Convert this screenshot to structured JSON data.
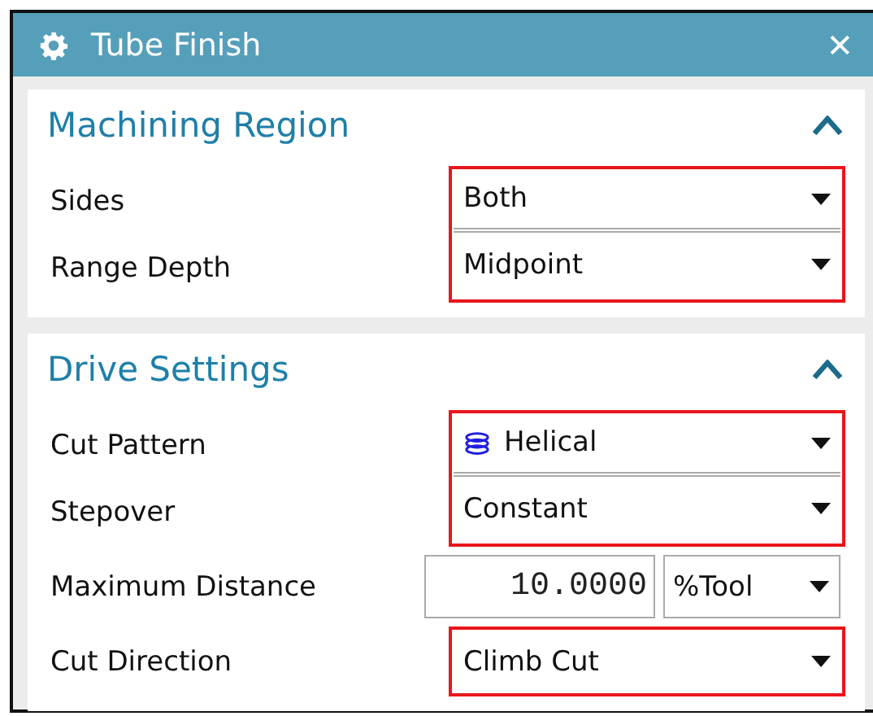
{
  "window": {
    "title": "Tube Finish",
    "close": "✕"
  },
  "sections": [
    {
      "title": "Machining Region",
      "expanded": true,
      "blocks": [
        {
          "highlighted": true,
          "rows": [
            {
              "label": "Sides",
              "kind": "dropdown",
              "value": "Both"
            },
            {
              "label": "Range Depth",
              "kind": "dropdown",
              "value": "Midpoint"
            }
          ]
        }
      ]
    },
    {
      "title": "Drive Settings",
      "expanded": true,
      "blocks": [
        {
          "highlighted": true,
          "rows": [
            {
              "label": "Cut Pattern",
              "kind": "icon_dropdown",
              "value": "Helical"
            },
            {
              "label": "Stepover",
              "kind": "dropdown",
              "value": "Constant"
            }
          ]
        },
        {
          "highlighted": false,
          "rows": [
            {
              "label": "Maximum Distance",
              "kind": "number",
              "value": "10.0000",
              "unit": "%Tool"
            }
          ]
        },
        {
          "highlighted": true,
          "rows": [
            {
              "label": "Cut Direction",
              "kind": "dropdown",
              "value": "Climb Cut"
            }
          ]
        }
      ]
    }
  ]
}
